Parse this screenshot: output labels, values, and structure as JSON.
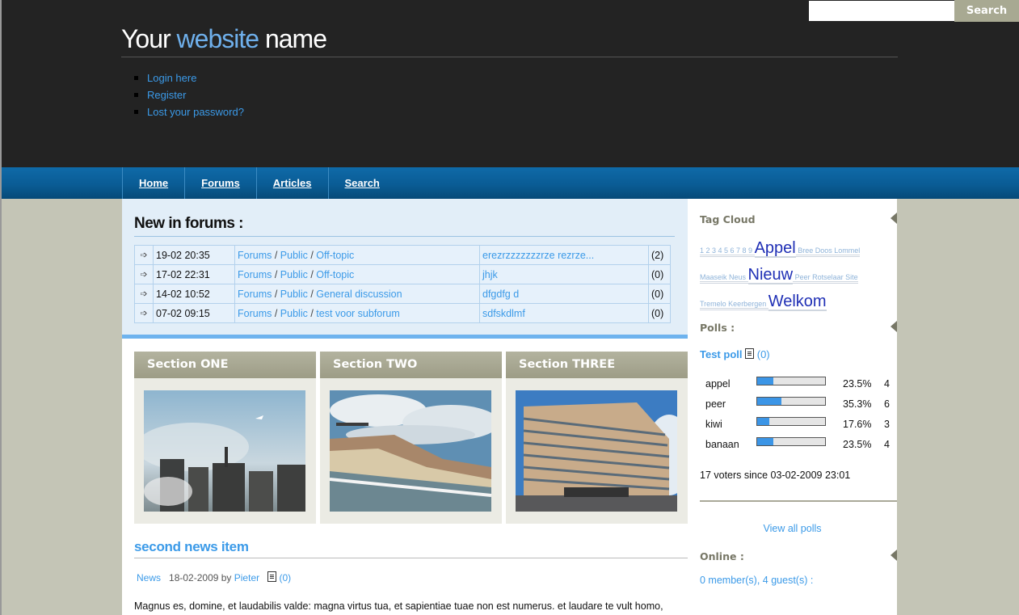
{
  "header": {
    "search_button": "Search",
    "search_placeholder": "",
    "title_part1": "Your ",
    "title_highlight": "website",
    "title_part2": " name",
    "links": [
      "Login here",
      "Register",
      "Lost your password?"
    ]
  },
  "nav": {
    "items": [
      "Home",
      "Forums",
      "Articles",
      "Search"
    ]
  },
  "forums": {
    "heading": "New in forums :",
    "rows": [
      {
        "date": "19-02 20:35",
        "p1": "Forums",
        "p2": "Public",
        "p3": "Off-topic",
        "topic": "erezrzzzzzzzrze rezrze...",
        "count": "(2)"
      },
      {
        "date": "17-02 22:31",
        "p1": "Forums",
        "p2": "Public",
        "p3": "Off-topic",
        "topic": "jhjk",
        "count": "(0)"
      },
      {
        "date": "14-02 10:52",
        "p1": "Forums",
        "p2": "Public",
        "p3": "General discussion",
        "topic": "dfgdfg d",
        "count": "(0)"
      },
      {
        "date": "07-02 09:15",
        "p1": "Forums",
        "p2": "Public",
        "p3": "test voor subforum",
        "topic": "sdfskdlmf",
        "count": "(0)"
      }
    ],
    "separator": " / "
  },
  "sections": [
    "Section ONE",
    "Section TWO",
    "Section THREE"
  ],
  "news": {
    "title": "second news item",
    "category": "News",
    "date": "18-02-2009 by ",
    "author": "Pieter",
    "comments": "(0)",
    "body": "Magnus es, domine, et laudabilis valde: magna virtus tua, et sapientiae tuae non est numerus. et laudare te vult homo,"
  },
  "sidebar": {
    "tag_heading": "Tag Cloud",
    "tags_line1_small": "1 2 3 4 5 6 7 8 9 ",
    "tags_line1_big": "Appel",
    "tags_line1_small2": " Bree Doos Lommel",
    "tags_line2_small": "Maaseik Neus ",
    "tags_line2_big": "Nieuw",
    "tags_line2_small2": " Peer Rotselaar Site",
    "tags_line3_small": "Tremelo Keerbergen ",
    "tags_line3_big": "Welkom",
    "polls_heading": "Polls :",
    "poll_title": "Test poll",
    "poll_comments": "(0)",
    "poll_options": [
      {
        "label": "appel",
        "percent": "23.5%",
        "votes": "4",
        "fraction": 0.235
      },
      {
        "label": "peer",
        "percent": "35.3%",
        "votes": "6",
        "fraction": 0.353
      },
      {
        "label": "kiwi",
        "percent": "17.6%",
        "votes": "3",
        "fraction": 0.176
      },
      {
        "label": "banaan",
        "percent": "23.5%",
        "votes": "4",
        "fraction": 0.235
      }
    ],
    "voters": "17 voters since 03-02-2009 23:01",
    "view_all": "View all polls",
    "online_heading": "Online :",
    "online_text": "0 member(s), 4 guest(s) :"
  },
  "colors": {
    "accent": "#3b9ae8",
    "header_bg": "#232323",
    "nav_bg": "#0a5c95"
  }
}
